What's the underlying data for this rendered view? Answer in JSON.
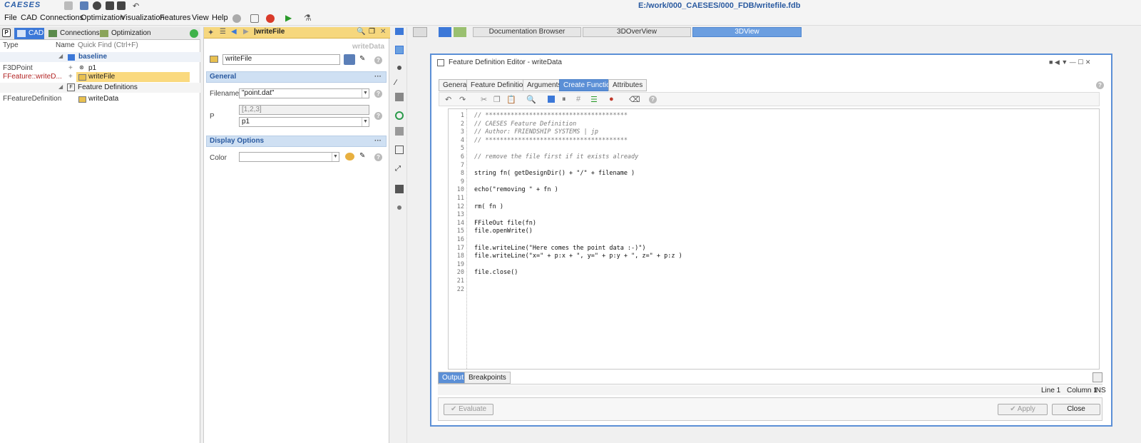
{
  "app": {
    "logo": "CAESES",
    "file_path": "E:/work/000_CAESES/000_FDB/writefile.fdb"
  },
  "menu": [
    "File",
    "CAD",
    "Connections",
    "Optimization",
    "Visualization",
    "Features",
    "View",
    "Help"
  ],
  "left_panel": {
    "tabs": [
      "CAD",
      "Connections",
      "Optimization"
    ],
    "columns": {
      "type": "Type",
      "name": "Name",
      "quick_find": "Quick Find (Ctrl+F)"
    },
    "tree": [
      {
        "type": "",
        "name": "baseline",
        "kind": "folder"
      },
      {
        "type": "F3DPoint",
        "name": "p1",
        "kind": "point"
      },
      {
        "type": "FFeature::writeD...",
        "name": "writeFile",
        "kind": "feature",
        "selected": true
      },
      {
        "type": "",
        "name": "Feature Definitions",
        "kind": "group"
      },
      {
        "type": "FFeatureDefinition",
        "name": "writeData",
        "kind": "definition"
      }
    ]
  },
  "mid_panel": {
    "header_title": "|writeFile",
    "subtitle": "writeData",
    "name_value": "writeFile",
    "general": {
      "title": "General",
      "filename_label": "Filename",
      "filename_value": "\"point.dat\"",
      "p_label": "P",
      "p_readonly": "[1,2,3]",
      "p_value": "p1"
    },
    "display": {
      "title": "Display Options",
      "color_label": "Color",
      "color_value": ""
    }
  },
  "right_tabs": [
    "Documentation Browser",
    "3DOverView",
    "3DView"
  ],
  "editor": {
    "title": "Feature Definition Editor - writeData",
    "tabs": [
      "General",
      "Feature Definitions",
      "Arguments",
      "Create Function",
      "Attributes"
    ],
    "active_tab": "Create Function",
    "code_lines": [
      "// ***************************************",
      "// CAESES Feature Definition",
      "// Author: FRIENDSHIP SYSTEMS | jp",
      "// ***************************************",
      "",
      "// remove the file first if it exists already",
      "",
      "string fn( getDesignDir() + \"/\" + filename )",
      "",
      "echo(\"removing \" + fn )",
      "",
      "rm( fn )",
      "",
      "FFileOut file(fn)",
      "file.openWrite()",
      "",
      "file.writeLine(\"Here comes the point data :-)\")",
      "file.writeLine(\"x=\" + p:x + \", y=\" + p:y + \", z=\" + p:z )",
      "",
      "file.close()",
      "",
      ""
    ],
    "bottom_tabs": [
      "Output",
      "Breakpoints"
    ],
    "status": {
      "line": "Line 1",
      "column": "Column 1",
      "mode": "INS"
    },
    "buttons": {
      "evaluate": "Evaluate",
      "apply": "Apply",
      "close": "Close"
    }
  }
}
